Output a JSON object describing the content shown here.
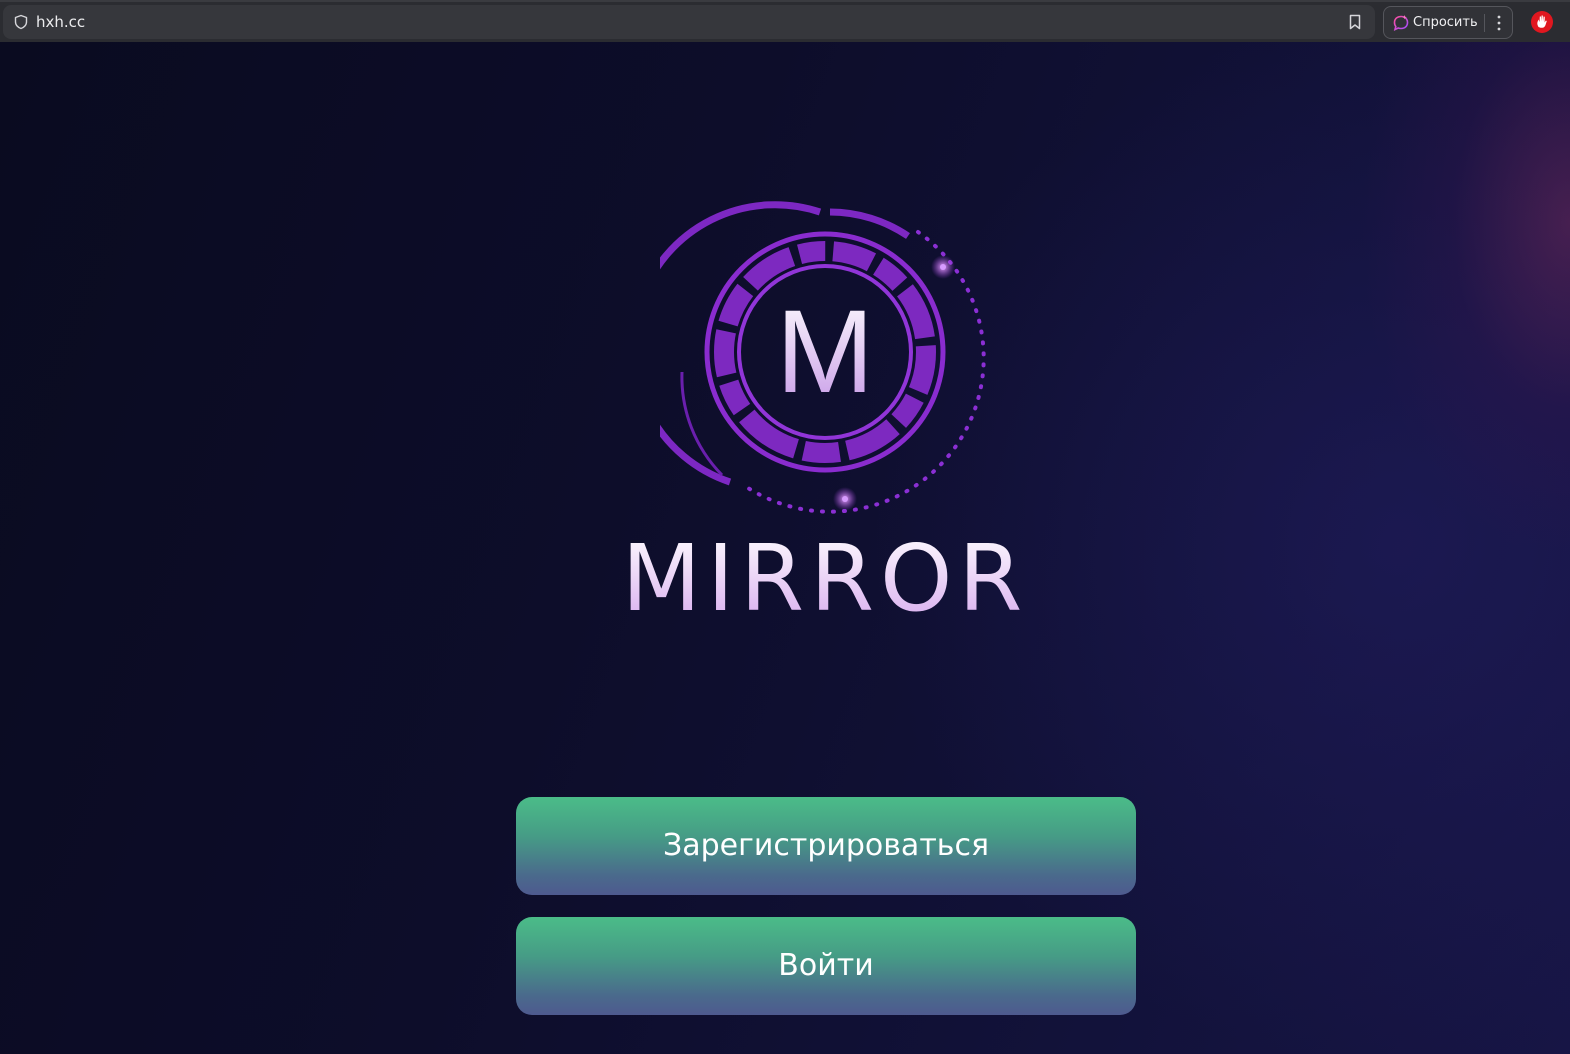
{
  "browser": {
    "url": "hxh.cc",
    "ask_label": "Спросить",
    "icons": {
      "security": "shield-icon",
      "bookmark": "bookmark-icon",
      "ask": "sparkle-chat-icon",
      "menu": "vertical-dots-icon",
      "extension": "red-hand-icon"
    }
  },
  "brand": {
    "logo_letter": "M",
    "name": "MIRROR",
    "accent_color": "#8a2ccf"
  },
  "actions": {
    "register_label": "Зарегистрироваться",
    "login_label": "Войти",
    "button_color_top": "#4bbc88",
    "button_color_bottom": "#4e5a8f"
  }
}
